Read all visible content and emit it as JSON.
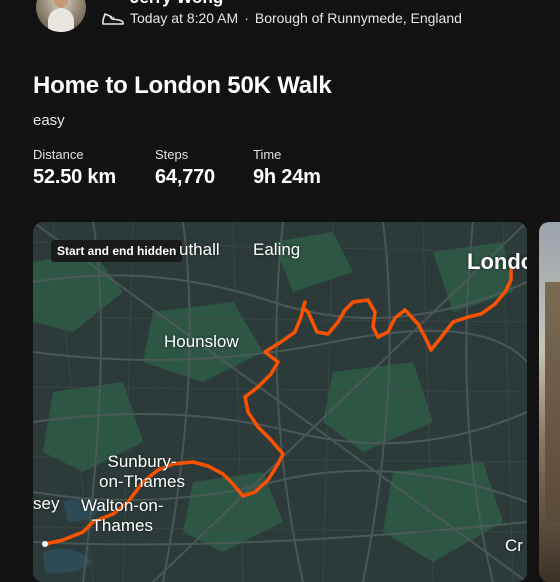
{
  "activity": {
    "athlete_name": "Jerry Wong",
    "timestamp": "Today at 8:20 AM",
    "location": "Borough of Runnymede, England",
    "activity_icon": "shoe-icon",
    "title": "Home to London 50K Walk",
    "description": "easy"
  },
  "stats": [
    {
      "label": "Distance",
      "value": "52.50 km"
    },
    {
      "label": "Steps",
      "value": "64,770"
    },
    {
      "label": "Time",
      "value": "9h 24m"
    }
  ],
  "map": {
    "badge": "Start and end hidden",
    "route_color": "#fc5200",
    "labels": {
      "southall": "uthall",
      "ealing": "Ealing",
      "london": "London",
      "hounslow": "Hounslow",
      "sunbury": "Sunbury-on-Thames",
      "sunbury_line1": "Sunbury-",
      "sunbury_line2": "on-Thames",
      "walton_line1": "Walton-on-",
      "walton_line2": "Thames",
      "chertsey": "sey",
      "croydon": "Cr"
    }
  }
}
